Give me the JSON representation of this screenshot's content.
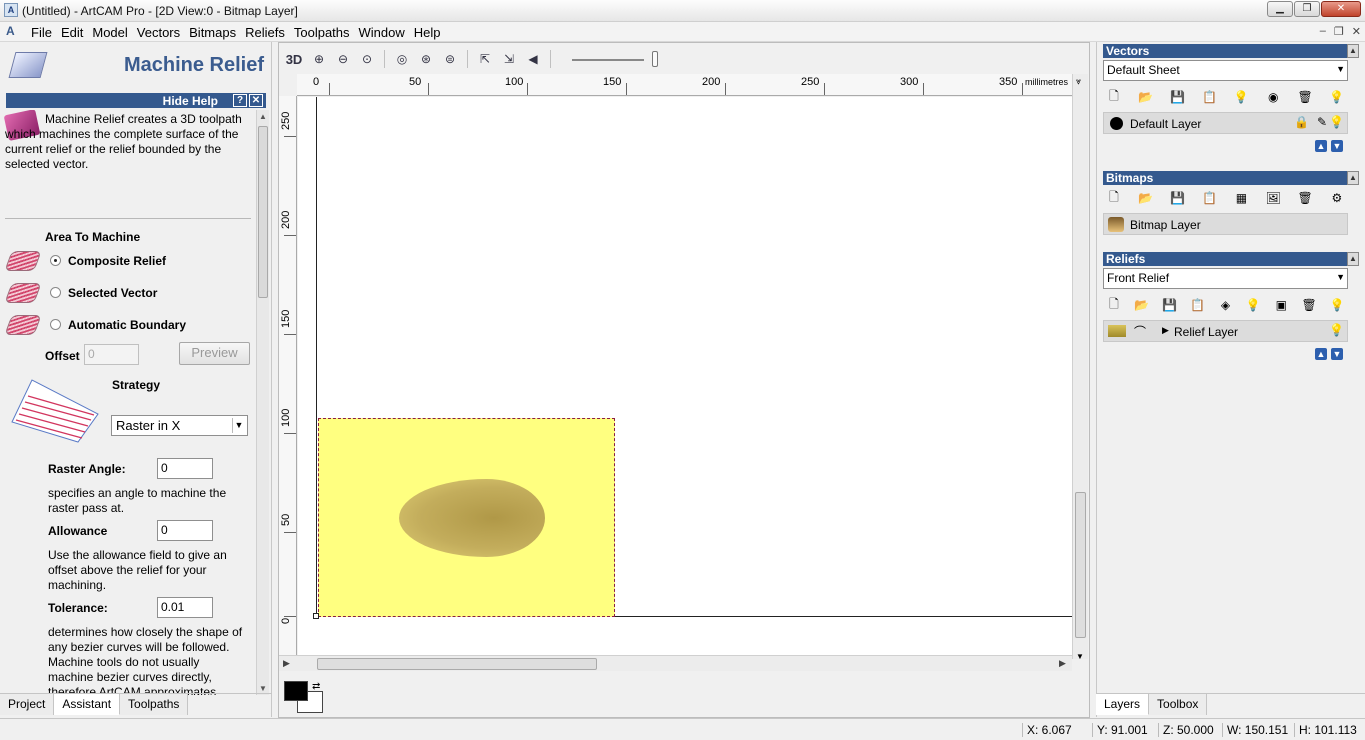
{
  "window": {
    "title": "(Untitled) - ArtCAM Pro - [2D View:0 - Bitmap Layer]",
    "app_icon": "artcam-logo-icon"
  },
  "menu": [
    "File",
    "Edit",
    "Model",
    "Vectors",
    "Bitmaps",
    "Reliefs",
    "Toolpaths",
    "Window",
    "Help"
  ],
  "left_panel": {
    "title": "Machine Relief",
    "hide_help": "Hide Help",
    "help_btn": "?",
    "close_btn": "✕",
    "help_text": "Machine Relief creates a 3D toolpath which machines the complete surface of the current relief or the relief bounded by the selected vector.",
    "area_title": "Area To Machine",
    "options": [
      "Composite Relief",
      "Selected Vector",
      "Automatic Boundary"
    ],
    "selected_option": 0,
    "offset_label": "Offset",
    "offset_value": "0",
    "preview_label": "Preview",
    "strategy_label": "Strategy",
    "strategy_value": "Raster in X",
    "raster_angle_label": "Raster Angle:",
    "raster_angle_value": "0",
    "raster_angle_desc": "specifies an angle to machine the raster pass at.",
    "allowance_label": "Allowance",
    "allowance_value": "0",
    "allowance_desc": "Use the allowance field to give an offset above the relief for your machining.",
    "tolerance_label": "Tolerance:",
    "tolerance_value": "0.01",
    "tolerance_desc": "determines how closely the shape of any bezier curves will be followed. Machine tools do not usually machine bezier curves directly, therefore ArtCAM approximates these curves with small straight line moves. Entering excessively small",
    "tabs": [
      "Project",
      "Assistant",
      "Toolpaths"
    ],
    "active_tab": "Assistant"
  },
  "view": {
    "toolbar_3d": "3D",
    "ruler_units": "millimetres",
    "h_labels": [
      "0",
      "50",
      "100",
      "150",
      "200",
      "250",
      "300",
      "350"
    ],
    "v_labels": [
      "250",
      "200",
      "150",
      "100",
      "50",
      "0"
    ]
  },
  "right_panel": {
    "vectors": {
      "title": "Vectors",
      "sheet": "Default Sheet",
      "layer": "Default Layer"
    },
    "bitmaps": {
      "title": "Bitmaps",
      "layer": "Bitmap Layer"
    },
    "reliefs": {
      "title": "Reliefs",
      "select": "Front Relief",
      "layer": "Relief Layer"
    },
    "tabs": [
      "Layers",
      "Toolbox"
    ],
    "active_tab": "Layers"
  },
  "status": {
    "x": "X: 6.067",
    "y": "Y: 91.001",
    "z": "Z: 50.000",
    "w": "W: 150.151",
    "h": "H: 101.113"
  },
  "colors": {
    "panel_header": "#34598e",
    "bitmap_fill": "#ffff80",
    "bitmap_border": "#8b1c45"
  }
}
